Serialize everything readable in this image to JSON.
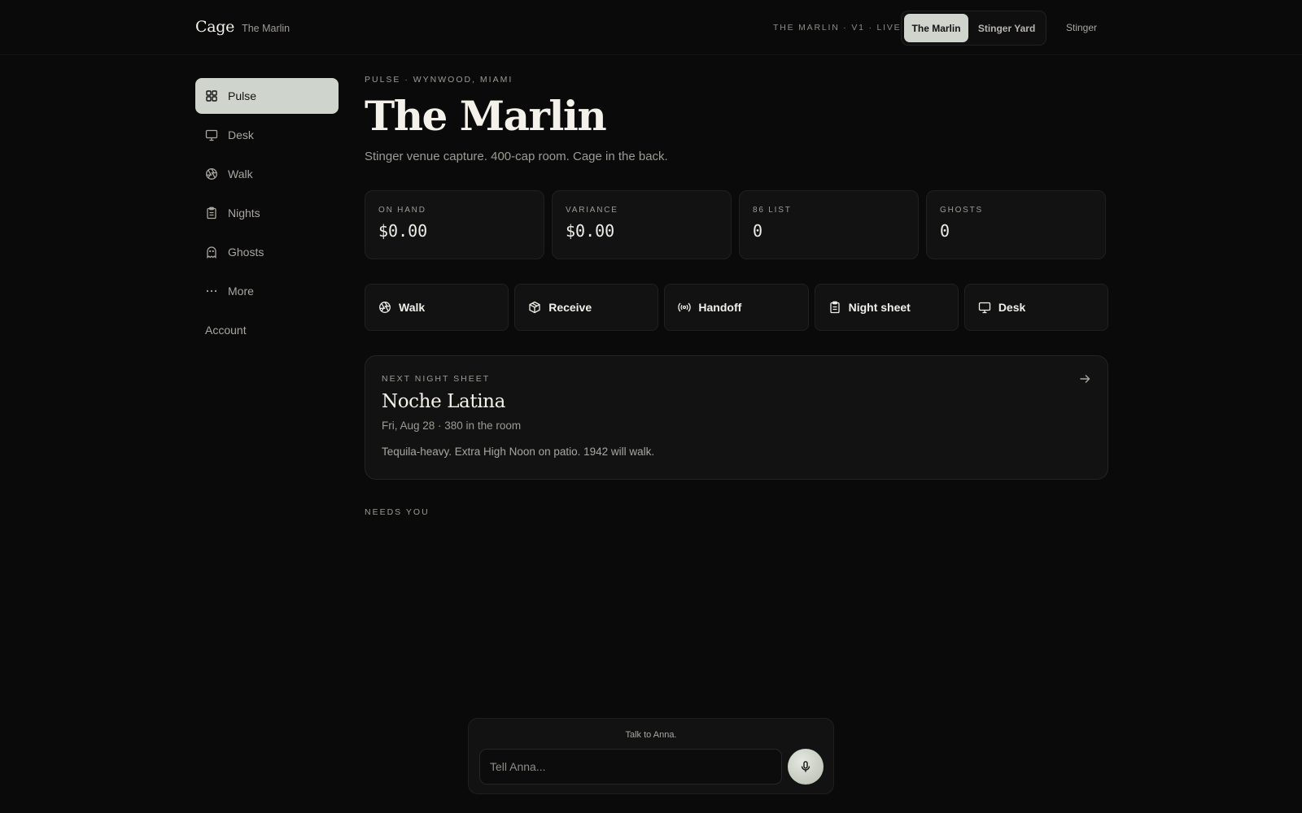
{
  "header": {
    "brand": "Cage",
    "brand_sub": "The Marlin",
    "env_label": "THE MARLIN · V1 · LIVE",
    "venues": [
      "The Marlin",
      "Stinger Yard"
    ],
    "user": "Stinger"
  },
  "sidebar": {
    "items": [
      {
        "label": "Pulse",
        "icon": "grid-icon"
      },
      {
        "label": "Desk",
        "icon": "monitor-icon"
      },
      {
        "label": "Walk",
        "icon": "aperture-icon"
      },
      {
        "label": "Nights",
        "icon": "clipboard-icon"
      },
      {
        "label": "Ghosts",
        "icon": "ghost-icon"
      },
      {
        "label": "More",
        "icon": "more-icon"
      }
    ],
    "account": "Account"
  },
  "main": {
    "eyebrow": "PULSE · WYNWOOD, MIAMI",
    "title": "The Marlin",
    "subtitle": "Stinger venue capture. 400-cap room. Cage in the back.",
    "stats": [
      {
        "label": "ON HAND",
        "value": "$0.00"
      },
      {
        "label": "VARIANCE",
        "value": "$0.00"
      },
      {
        "label": "86 LIST",
        "value": "0"
      },
      {
        "label": "GHOSTS",
        "value": "0"
      }
    ],
    "actions": [
      {
        "label": "Walk",
        "icon": "aperture-icon"
      },
      {
        "label": "Receive",
        "icon": "package-icon"
      },
      {
        "label": "Handoff",
        "icon": "radio-icon"
      },
      {
        "label": "Night sheet",
        "icon": "clipboard-icon"
      },
      {
        "label": "Desk",
        "icon": "monitor-icon"
      }
    ],
    "next_sheet": {
      "eyebrow": "NEXT NIGHT SHEET",
      "title": "Noche Latina",
      "meta": "Fri, Aug 28 · 380 in the room",
      "note": "Tequila-heavy. Extra High Noon on patio. 1942 will walk."
    },
    "needs_you": "NEEDS YOU"
  },
  "composer": {
    "label": "Talk to Anna.",
    "placeholder": "Tell Anna..."
  },
  "colors": {
    "background": "#0a0a0a",
    "accent": "#cfd5cc",
    "card": "#121212"
  }
}
